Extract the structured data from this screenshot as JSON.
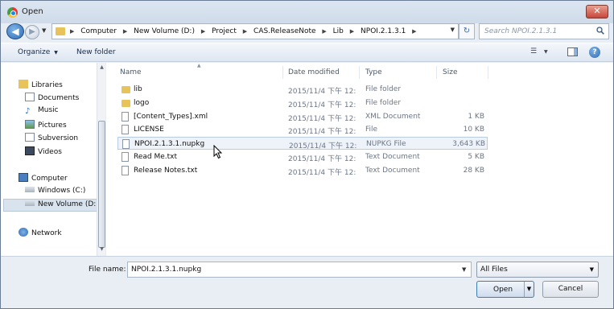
{
  "window": {
    "title": "Open",
    "close_glyph": "✕"
  },
  "nav": {
    "back_glyph": "◀",
    "fwd_glyph": "▶"
  },
  "address": {
    "crumbs": [
      "Computer",
      "New Volume (D:)",
      "Project",
      "CAS.ReleaseNote",
      "Lib",
      "NPOI.2.1.3.1"
    ],
    "refresh_glyph": "↻"
  },
  "search": {
    "placeholder": "Search NPOI.2.1.3.1"
  },
  "toolbar": {
    "organize": "Organize",
    "new_folder": "New folder",
    "help": "?"
  },
  "sidebar": {
    "items": [
      {
        "label": "Libraries",
        "icon": "libraries-icon"
      },
      {
        "label": "Documents",
        "icon": "documents-icon"
      },
      {
        "label": "Music",
        "icon": "music-icon"
      },
      {
        "label": "Pictures",
        "icon": "pictures-icon"
      },
      {
        "label": "Subversion",
        "icon": "subversion-icon"
      },
      {
        "label": "Videos",
        "icon": "videos-icon"
      },
      {
        "label": "Computer",
        "icon": "computer-icon"
      },
      {
        "label": "Windows  (C:)",
        "icon": "drive-icon"
      },
      {
        "label": "New Volume (D:)",
        "icon": "drive-icon"
      },
      {
        "label": "Network",
        "icon": "network-icon"
      }
    ],
    "selected_index": 8
  },
  "filelist": {
    "columns": {
      "name": "Name",
      "date": "Date modified",
      "type": "Type",
      "size": "Size"
    },
    "rows": [
      {
        "name": "lib",
        "date": "2015/11/4 下午 12:...",
        "type": "File folder",
        "size": "",
        "icon": "folder-icon"
      },
      {
        "name": "logo",
        "date": "2015/11/4 下午 12:...",
        "type": "File folder",
        "size": "",
        "icon": "folder-icon"
      },
      {
        "name": "[Content_Types].xml",
        "date": "2015/11/4 下午 12:...",
        "type": "XML Document",
        "size": "1 KB",
        "icon": "xml-file-icon"
      },
      {
        "name": "LICENSE",
        "date": "2015/11/4 下午 12:...",
        "type": "File",
        "size": "10 KB",
        "icon": "file-icon"
      },
      {
        "name": "NPOI.2.1.3.1.nupkg",
        "date": "2015/11/4 下午 12:...",
        "type": "NUPKG File",
        "size": "3,643 KB",
        "icon": "file-icon"
      },
      {
        "name": "Read Me.txt",
        "date": "2015/11/4 下午 12:...",
        "type": "Text Document",
        "size": "5 KB",
        "icon": "text-file-icon"
      },
      {
        "name": "Release Notes.txt",
        "date": "2015/11/4 下午 12:...",
        "type": "Text Document",
        "size": "28 KB",
        "icon": "text-file-icon"
      }
    ],
    "selected_index": 4
  },
  "bottom": {
    "file_name_label": "File name:",
    "file_name_value": "NPOI.2.1.3.1.nupkg",
    "filter": "All Files",
    "open": "Open",
    "cancel": "Cancel"
  }
}
